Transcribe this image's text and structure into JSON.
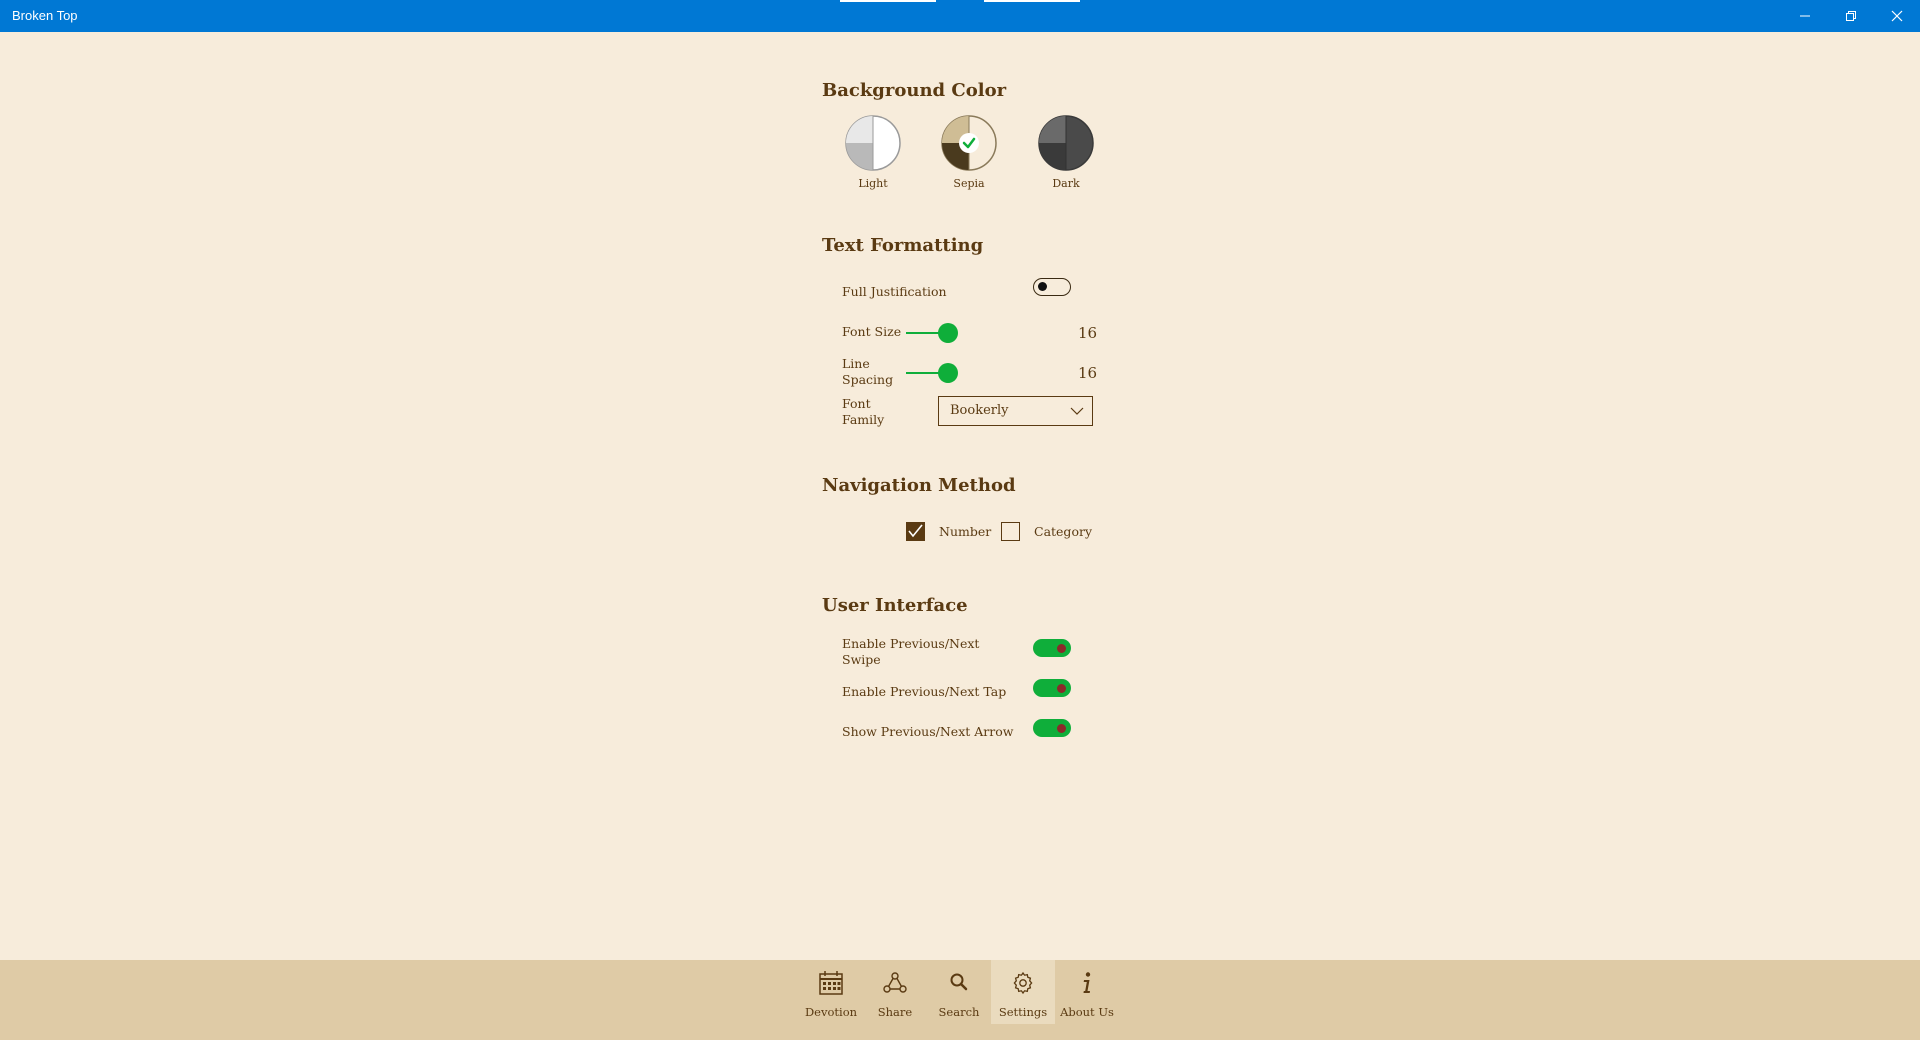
{
  "window": {
    "title": "Broken Top"
  },
  "background_color": {
    "title": "Background Color",
    "options": [
      {
        "label": "Light",
        "selected": false
      },
      {
        "label": "Sepia",
        "selected": true
      },
      {
        "label": "Dark",
        "selected": false
      }
    ]
  },
  "text_formatting": {
    "title": "Text Formatting",
    "full_justification": {
      "label": "Full Justification",
      "enabled": false
    },
    "font_size": {
      "label": "Font Size",
      "value": "16"
    },
    "line_spacing": {
      "label_line1": "Line",
      "label_line2": "Spacing",
      "value": "16"
    },
    "font_family": {
      "label_line1": "Font",
      "label_line2": "Family",
      "selected": "Bookerly"
    }
  },
  "navigation_method": {
    "title": "Navigation Method",
    "options": [
      {
        "label": "Number",
        "checked": true
      },
      {
        "label": "Category",
        "checked": false
      }
    ]
  },
  "user_interface": {
    "title": "User Interface",
    "swipe": {
      "label_line1": "Enable Previous/Next",
      "label_line2": "Swipe",
      "enabled": true
    },
    "tap": {
      "label": "Enable Previous/Next Tap",
      "enabled": true
    },
    "arrow": {
      "label": "Show Previous/Next Arrow",
      "enabled": true
    }
  },
  "bottom_nav": {
    "items": [
      {
        "label": "Devotion",
        "icon": "calendar-icon"
      },
      {
        "label": "Share",
        "icon": "share-icon"
      },
      {
        "label": "Search",
        "icon": "search-icon"
      },
      {
        "label": "Settings",
        "icon": "gear-icon",
        "active": true
      },
      {
        "label": "About Us",
        "icon": "info-icon"
      }
    ]
  },
  "colors": {
    "titlebar": "#0078d4",
    "background": "#f7ecdb",
    "accent": "#0fae3a",
    "text": "#5a3a12",
    "bottombar": "#dfcba6"
  }
}
